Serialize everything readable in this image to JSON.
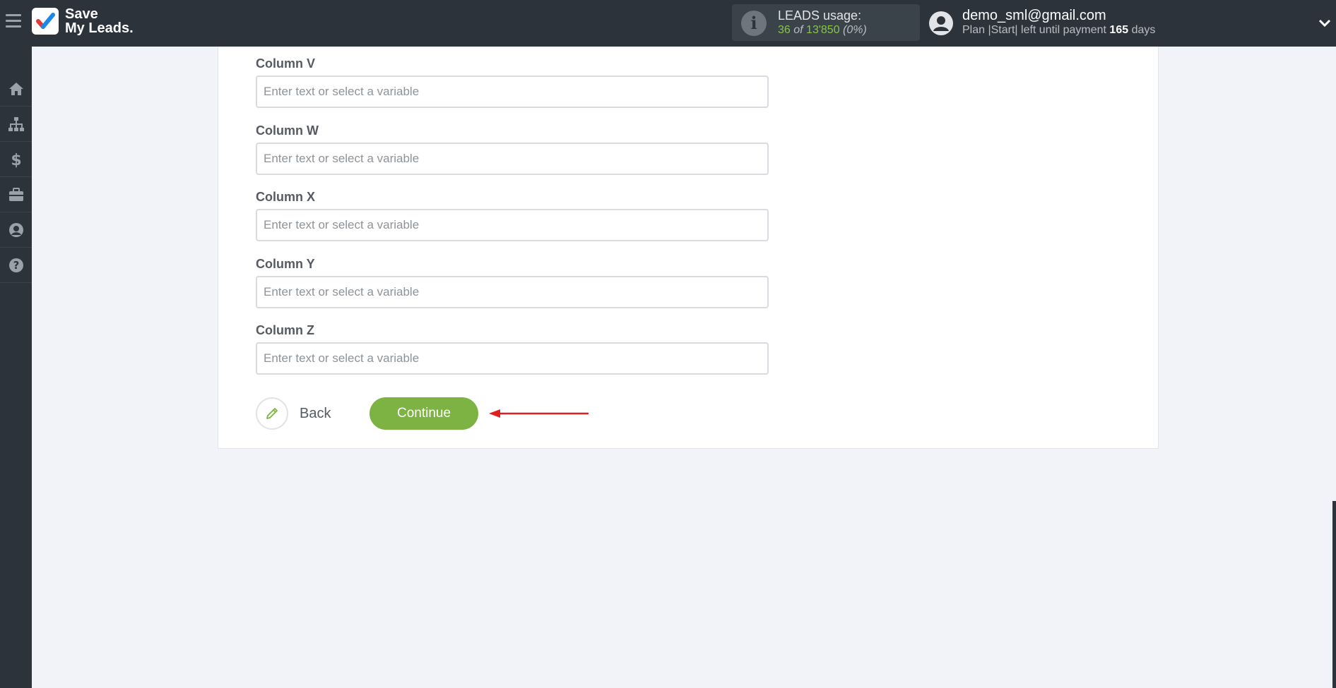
{
  "header": {
    "logo_line1": "Save",
    "logo_line2": "My Leads.",
    "usage_title": "LEADS usage:",
    "usage_used": "36",
    "usage_of": "of",
    "usage_total": "13'850",
    "usage_percent": "(0%)",
    "user_email": "demo_sml@gmail.com",
    "plan_text": "Plan |Start| left until payment",
    "plan_days": "165",
    "plan_days_suffix": "days"
  },
  "sidebar": {
    "items": [
      "home-icon",
      "sitemap-icon",
      "dollar-icon",
      "briefcase-icon",
      "user-circle-icon",
      "question-icon"
    ]
  },
  "form": {
    "fields": [
      {
        "label": "Column V",
        "placeholder": "Enter text or select a variable",
        "value": ""
      },
      {
        "label": "Column W",
        "placeholder": "Enter text or select a variable",
        "value": ""
      },
      {
        "label": "Column X",
        "placeholder": "Enter text or select a variable",
        "value": ""
      },
      {
        "label": "Column Y",
        "placeholder": "Enter text or select a variable",
        "value": ""
      },
      {
        "label": "Column Z",
        "placeholder": "Enter text or select a variable",
        "value": ""
      }
    ],
    "back_label": "Back",
    "continue_label": "Continue"
  },
  "colors": {
    "accent": "#7cb342",
    "topbar": "#2c333b",
    "annotation_arrow": "#e02020"
  }
}
